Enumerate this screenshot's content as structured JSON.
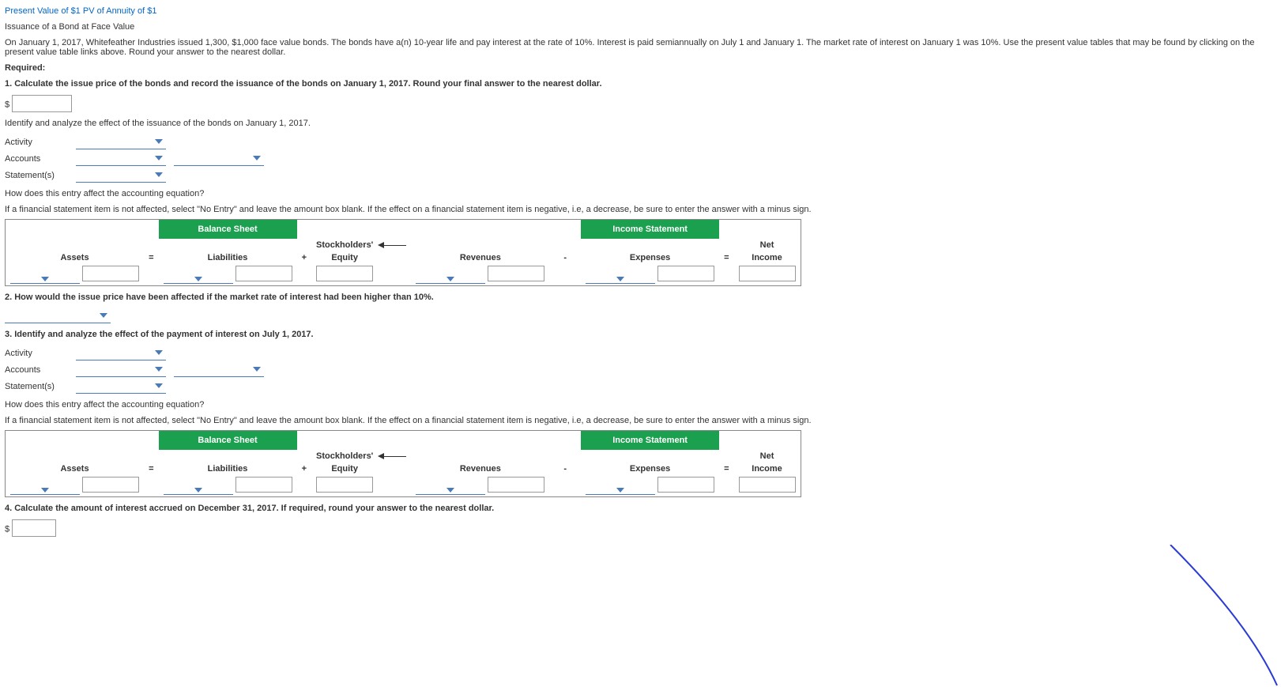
{
  "links": {
    "pv1": "Present Value of $1",
    "pva1": "PV of Annuity of $1"
  },
  "title": "Issuance of a Bond at Face Value",
  "problem": "On January 1, 2017, Whitefeather Industries issued 1,300, $1,000 face value bonds. The bonds have a(n) 10-year life and pay interest at the rate of 10%. Interest is paid semiannually on July 1 and January 1. The market rate of interest on January 1 was 10%. Use the present value tables that may be found by clicking on the present value table links above. Round your answer to the nearest dollar.",
  "required": "Required:",
  "q1": "1.  Calculate the issue price of the bonds and record the issuance of the bonds on January 1, 2017. Round your final answer to the nearest dollar.",
  "dollar": "$",
  "identify1": "Identify and analyze the effect of the issuance of the bonds on January 1, 2017.",
  "rows": {
    "activity": "Activity",
    "accounts": "Accounts",
    "statements": "Statement(s)"
  },
  "how": "How does this entry affect the accounting equation?",
  "note": "If a financial statement item is not affected, select \"No Entry\" and leave the amount box blank. If the effect on a financial statement item is negative, i.e, a decrease, be sure to enter the answer with a minus sign.",
  "headers": {
    "bs": "Balance Sheet",
    "is": "Income Statement",
    "assets": "Assets",
    "liab": "Liabilities",
    "se1": "Stockholders'",
    "se2": "Equity",
    "rev": "Revenues",
    "exp": "Expenses",
    "net": "Net",
    "inc": "Income"
  },
  "q2": "2.  How would the issue price have been affected if the market rate of interest had been higher than 10%.",
  "q3": "3.  Identify and analyze the effect of the payment of interest on July 1, 2017.",
  "q4": "4.  Calculate the amount of interest accrued on December 31, 2017. If required, round your answer to the nearest dollar."
}
